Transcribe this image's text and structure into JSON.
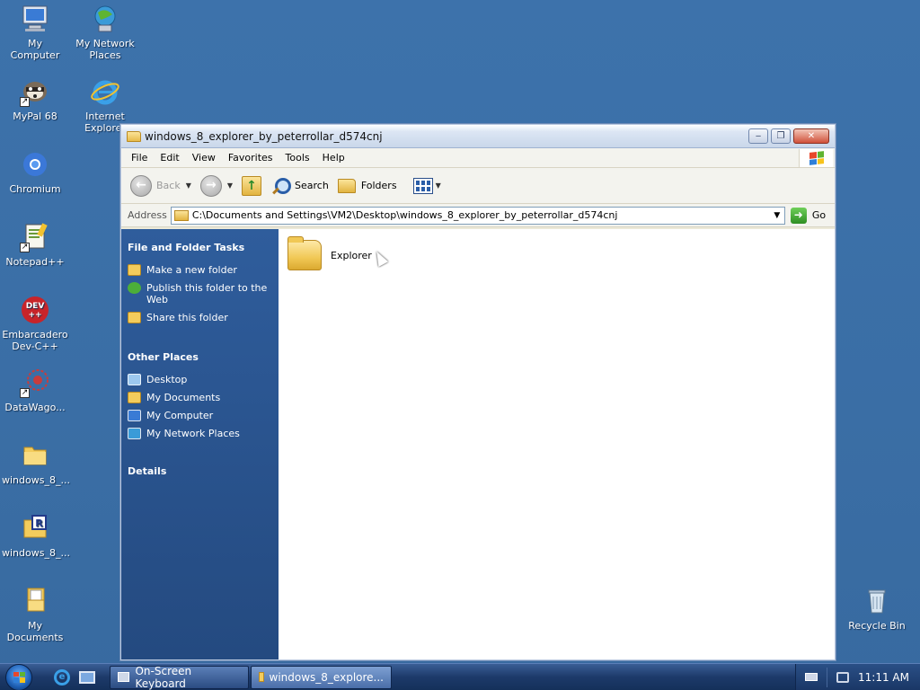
{
  "desktop": {
    "icons": [
      {
        "label": "My Computer",
        "icon": "computer-icon"
      },
      {
        "label": "My Network Places",
        "icon": "network-icon"
      },
      {
        "label": "MyPal 68",
        "icon": "raccoon-browser-icon"
      },
      {
        "label": "Internet Explorer",
        "icon": "ie-icon"
      },
      {
        "label": "Chromium",
        "icon": "chromium-icon"
      },
      {
        "label": "Notepad++",
        "icon": "notepad-icon"
      },
      {
        "label": "Embarcadero Dev-C++",
        "icon": "devcpp-icon"
      },
      {
        "label": "DataWago...",
        "icon": "datawagon-icon"
      },
      {
        "label": "windows_8_...",
        "icon": "folder-icon"
      },
      {
        "label": "windows_8_...",
        "icon": "rar-archive-icon"
      },
      {
        "label": "My Documents",
        "icon": "documents-icon"
      },
      {
        "label": "Recycle Bin",
        "icon": "recycle-bin-icon"
      }
    ],
    "devcpp_badge": "DEV\n++"
  },
  "window": {
    "title": "windows_8_explorer_by_peterrollar_d574cnj",
    "controls": {
      "minimize": "‒",
      "maximize": "❐",
      "close": "✕"
    },
    "menu": [
      "File",
      "Edit",
      "View",
      "Favorites",
      "Tools",
      "Help"
    ],
    "toolbar": {
      "back_label": "Back",
      "search_label": "Search",
      "folders_label": "Folders"
    },
    "address": {
      "label": "Address",
      "path": "C:\\Documents and Settings\\VM2\\Desktop\\windows_8_explorer_by_peterrollar_d574cnj",
      "go_label": "Go"
    },
    "taskpane": {
      "file_tasks_title": "File and Folder Tasks",
      "file_tasks": [
        {
          "label": "Make a new folder",
          "icon": "new-folder-icon"
        },
        {
          "label": "Publish this folder to the Web",
          "icon": "publish-web-icon"
        },
        {
          "label": "Share this folder",
          "icon": "share-folder-icon"
        }
      ],
      "other_places_title": "Other Places",
      "other_places": [
        {
          "label": "Desktop",
          "icon": "desktop-icon"
        },
        {
          "label": "My Documents",
          "icon": "documents-icon"
        },
        {
          "label": "My Computer",
          "icon": "computer-icon"
        },
        {
          "label": "My Network Places",
          "icon": "network-icon"
        }
      ],
      "details_title": "Details"
    },
    "files": [
      {
        "name": "Explorer",
        "icon": "folder-icon"
      }
    ]
  },
  "taskbar": {
    "buttons": [
      {
        "label": "On-Screen Keyboard",
        "icon": "keyboard-icon"
      },
      {
        "label": "windows_8_explore...",
        "icon": "folder-icon"
      }
    ],
    "clock": "11:11 AM"
  },
  "colors": {
    "desktop": "#3a6ea5",
    "taskpane": "#2f5d9c",
    "xp_flag": [
      "#e8472b",
      "#5fb431",
      "#2f7fd8",
      "#f7c31c"
    ]
  }
}
